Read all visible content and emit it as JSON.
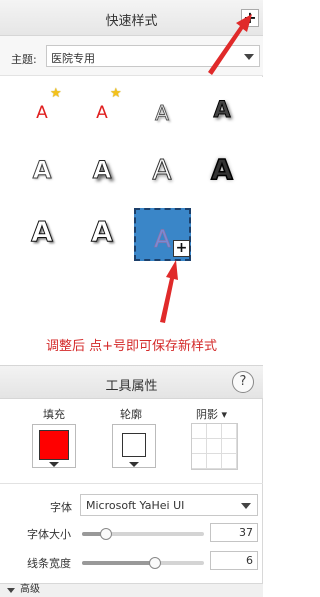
{
  "quick_style": {
    "title": "快速样式",
    "add_symbol": "+",
    "theme_label": "主题:",
    "theme_value": "医院专用"
  },
  "styles": {
    "glyph": "A",
    "star_symbol": "★",
    "selected_plus": "+",
    "hint": "调整后  点+号即可保存新样式"
  },
  "tool_props": {
    "title": "工具属性",
    "help_symbol": "?",
    "fill_label": "填充",
    "outline_label": "轮廓",
    "shadow_label": "阴影 ▾",
    "fill_color": "#ff0000"
  },
  "font": {
    "font_label": "字体",
    "font_value": "Microsoft YaHei UI",
    "size_label": "字体大小",
    "size_value": "37",
    "size_level": 0.2,
    "line_label": "线条宽度",
    "line_value": "6",
    "line_level": 0.6
  },
  "advanced": {
    "label": "高级"
  },
  "colors": {
    "accent_red": "#e02020",
    "selected_bg": "#3a86c8"
  }
}
